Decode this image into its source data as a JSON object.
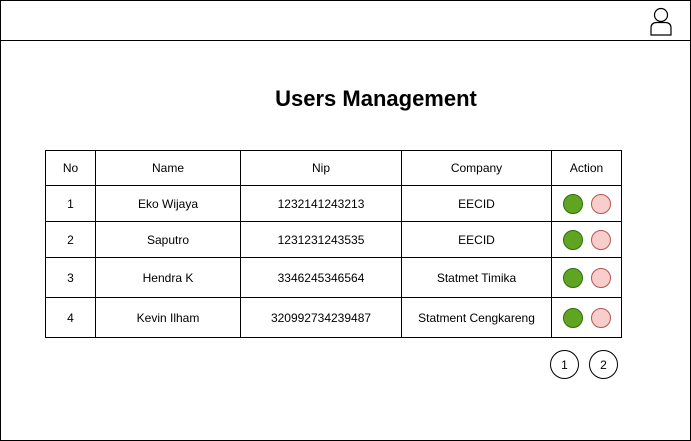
{
  "header": {
    "user_icon": "user-icon"
  },
  "page": {
    "title": "Users Management"
  },
  "table": {
    "columns": [
      "No",
      "Name",
      "Nip",
      "Company",
      "Action"
    ],
    "rows": [
      {
        "no": "1",
        "name": "Eko Wijaya",
        "nip": "1232141243213",
        "company": "EECID"
      },
      {
        "no": "2",
        "name": "Saputro",
        "nip": "1231231243535",
        "company": "EECID"
      },
      {
        "no": "3",
        "name": "Hendra K",
        "nip": "3346245346564",
        "company": "Statmet Timika"
      },
      {
        "no": "4",
        "name": "Kevin Ilham",
        "nip": "320992734239487",
        "company": "Statment Cengkareng"
      }
    ],
    "action_colors": {
      "edit": "#5fa521",
      "delete": "#f8cecc"
    }
  },
  "pagination": {
    "pages": [
      "1",
      "2"
    ]
  }
}
